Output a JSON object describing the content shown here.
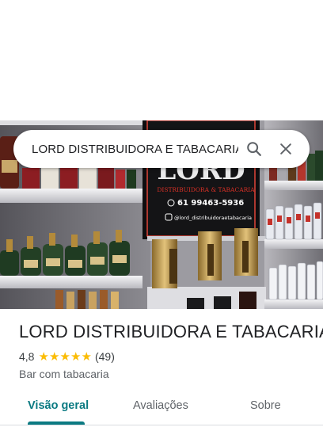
{
  "search": {
    "value": "LORD DISTRIBUIDORA E TABACARIA",
    "search_icon": "search-icon",
    "close_icon": "close-icon"
  },
  "photo": {
    "sign_logo": "LORD",
    "sign_subtitle": "DISTRIBUIDORA & TABACARIA",
    "sign_phone": "61 99463-5936",
    "sign_instagram": "@lord_distribuidoraetabacaria"
  },
  "place": {
    "title": "LORD DISTRIBUIDORA E TABACARIA",
    "rating": "4,8",
    "stars": 5,
    "reviews_count": "(49)",
    "category": "Bar com tabacaria"
  },
  "tabs": [
    {
      "label": "Visão geral",
      "active": true
    },
    {
      "label": "Avaliações",
      "active": false
    },
    {
      "label": "Sobre",
      "active": false
    }
  ],
  "colors": {
    "accent": "#0b7a82",
    "star": "#fbbc04",
    "sign_red": "#d93025"
  }
}
